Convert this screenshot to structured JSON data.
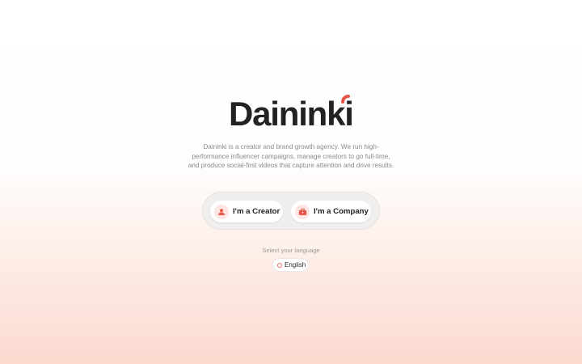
{
  "brand": {
    "name": "Daininki",
    "text_color": "#222222",
    "accent_color": "#e8564a"
  },
  "hero": {
    "description": "Daininki is a creator and brand growth agency. We run high-performance influencer campaigns, manage creators to go full-time, and produce social-first videos that capture attention and drive results."
  },
  "choices": {
    "creator": {
      "label": "I'm a Creator",
      "icon": "user-icon"
    },
    "company": {
      "label": "I'm a Company",
      "icon": "briefcase-icon"
    }
  },
  "language": {
    "prompt": "Select your language",
    "selected": "English",
    "icon": "globe-icon"
  }
}
